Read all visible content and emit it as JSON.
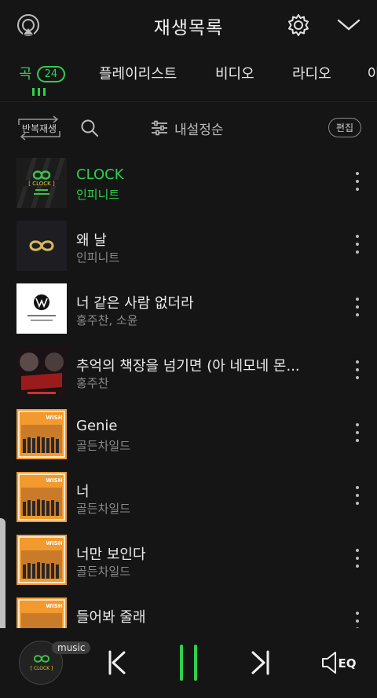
{
  "header": {
    "title": "재생목록"
  },
  "tabs": [
    {
      "label": "곡",
      "badge": "24",
      "active": true
    },
    {
      "label": "플레이리스트"
    },
    {
      "label": "비디오"
    },
    {
      "label": "라디오"
    },
    {
      "label": "아"
    }
  ],
  "toolbar": {
    "repeat_label": "반복재생",
    "sort_label": "내설정순",
    "edit_label": "편집"
  },
  "songs": [
    {
      "title": "CLOCK",
      "artist": "인피니트",
      "current": true,
      "art": "clock-cover"
    },
    {
      "title": "왜 날",
      "artist": "인피니트",
      "art": "infinite-logo-cover"
    },
    {
      "title": "너 같은 사람 없더라",
      "artist": "홍주찬, 소윤",
      "art": "w-cover"
    },
    {
      "title": "추억의 책장을 넘기면 (아 네모네 몬...",
      "artist": "홍주찬",
      "art": "drama-cover"
    },
    {
      "title": "Genie",
      "artist": "골든차일드",
      "art": "wish-cover"
    },
    {
      "title": "너",
      "artist": "골든차일드",
      "art": "wish-cover"
    },
    {
      "title": "너만 보인다",
      "artist": "골든차일드",
      "art": "wish-cover"
    },
    {
      "title": "들어봐 줄래",
      "artist": "",
      "art": "wish-cover"
    }
  ],
  "player": {
    "badge": "music",
    "eq_label": "EQ",
    "state": "playing"
  },
  "colors": {
    "accent": "#2fd04d",
    "background": "#151515"
  }
}
